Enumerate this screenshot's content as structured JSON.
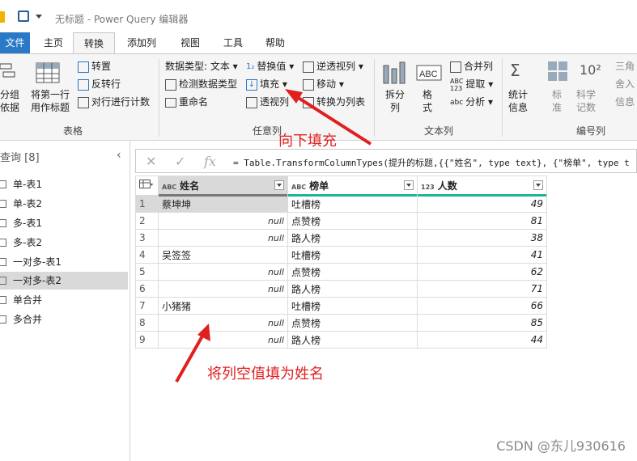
{
  "window": {
    "title": "无标题 - Power Query 编辑器"
  },
  "menu_tabs": [
    "文件",
    "主页",
    "转换",
    "添加列",
    "视图",
    "工具",
    "帮助"
  ],
  "active_tab": "转换",
  "ribbon": {
    "table_group": {
      "label": "表格",
      "group_by": "分组\n依据",
      "use_first_row": "将第一行\n用作标题",
      "transpose": "转置",
      "reverse_rows": "反转行",
      "count_rows": "对行进行计数"
    },
    "any_column_group": {
      "label": "任意列",
      "data_type": "数据类型: 文本",
      "detect_type": "检测数据类型",
      "rename": "重命名",
      "replace_values": "替换值",
      "fill": "填充",
      "pivot_column": "透视列",
      "unpivot": "逆透视列",
      "move": "移动",
      "convert_to_list": "转换为列表"
    },
    "text_column_group": {
      "label": "文本列",
      "split_column": "拆分\n列",
      "format": "格\n式",
      "merge_columns": "合并列",
      "extract": "提取",
      "parse": "分析"
    },
    "number_column_group": {
      "label": "编号列",
      "statistics": "统计\n信息",
      "standard": "标\n准",
      "scientific": "科学\n记数",
      "trig": "三角",
      "rounding": "舍入",
      "information": "信息"
    }
  },
  "queries": {
    "header": "查询 [8]",
    "items": [
      "单-表1",
      "单-表2",
      "多-表1",
      "多-表2",
      "一对多-表1",
      "一对多-表2",
      "单合并",
      "多合并"
    ],
    "selected_index": 5
  },
  "formula_bar": {
    "fx": "fx",
    "text": "= Table.TransformColumnTypes(提升的标题,{{\"姓名\", type text}, {\"榜单\", type t"
  },
  "table": {
    "columns": [
      {
        "type_icon": "ABC",
        "name": "姓名"
      },
      {
        "type_icon": "ABC",
        "name": "榜单"
      },
      {
        "type_icon": "123",
        "name": "人数"
      }
    ],
    "rows": [
      {
        "n": "1",
        "name": "蔡坤坤",
        "list": "吐槽榜",
        "count": "49"
      },
      {
        "n": "2",
        "name": "null",
        "list": "点赞榜",
        "count": "81"
      },
      {
        "n": "3",
        "name": "null",
        "list": "路人榜",
        "count": "38"
      },
      {
        "n": "4",
        "name": "吴签签",
        "list": "吐槽榜",
        "count": "41"
      },
      {
        "n": "5",
        "name": "null",
        "list": "点赞榜",
        "count": "62"
      },
      {
        "n": "6",
        "name": "null",
        "list": "路人榜",
        "count": "71"
      },
      {
        "n": "7",
        "name": "小猪猪",
        "list": "吐槽榜",
        "count": "66"
      },
      {
        "n": "8",
        "name": "null",
        "list": "点赞榜",
        "count": "85"
      },
      {
        "n": "9",
        "name": "null",
        "list": "路人榜",
        "count": "44"
      }
    ]
  },
  "annotations": {
    "fill_down": "向下填充",
    "fill_note": "将列空值填为姓名"
  },
  "watermark": "CSDN @东儿930616",
  "colors": {
    "accent": "#2a79c7",
    "annotation": "#e02020",
    "header_bar": "#1fb39a"
  }
}
